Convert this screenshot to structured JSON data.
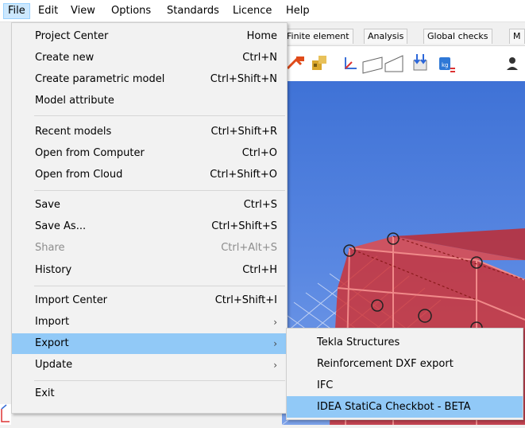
{
  "menubar": {
    "items": [
      "File",
      "Edit",
      "View",
      "Options",
      "Standards",
      "Licence",
      "Help"
    ]
  },
  "tabs": [
    "Finite element",
    "Analysis",
    "Global checks",
    "M"
  ],
  "file_menu": {
    "items": [
      {
        "label": "Project Center",
        "shortcut": "Home"
      },
      {
        "label": "Create new",
        "shortcut": "Ctrl+N"
      },
      {
        "label": "Create parametric model",
        "shortcut": "Ctrl+Shift+N"
      },
      {
        "label": "Model attribute",
        "shortcut": ""
      },
      {
        "label": "Recent models",
        "shortcut": "Ctrl+Shift+R"
      },
      {
        "label": "Open from Computer",
        "shortcut": "Ctrl+O"
      },
      {
        "label": "Open from Cloud",
        "shortcut": "Ctrl+Shift+O"
      },
      {
        "label": "Save",
        "shortcut": "Ctrl+S"
      },
      {
        "label": "Save As...",
        "shortcut": "Ctrl+Shift+S"
      },
      {
        "label": "Share",
        "shortcut": "Ctrl+Alt+S",
        "disabled": true
      },
      {
        "label": "History",
        "shortcut": "Ctrl+H"
      },
      {
        "label": "Import Center",
        "shortcut": "Ctrl+Shift+I"
      },
      {
        "label": "Import",
        "shortcut": "",
        "submenu": true
      },
      {
        "label": "Export",
        "shortcut": "",
        "submenu": true,
        "highlighted": true
      },
      {
        "label": "Update",
        "shortcut": "",
        "submenu": true
      },
      {
        "label": "Exit",
        "shortcut": ""
      }
    ]
  },
  "export_submenu": {
    "items": [
      {
        "label": "Tekla Structures"
      },
      {
        "label": "Reinforcement DXF export"
      },
      {
        "label": "IFC"
      },
      {
        "label": "IDEA StatiCa Checkbot - BETA",
        "highlighted": true
      }
    ]
  },
  "colors": {
    "highlight": "#91c9f7",
    "viewport_blue": "#4a7be0",
    "model_red": "#d32f2f"
  }
}
